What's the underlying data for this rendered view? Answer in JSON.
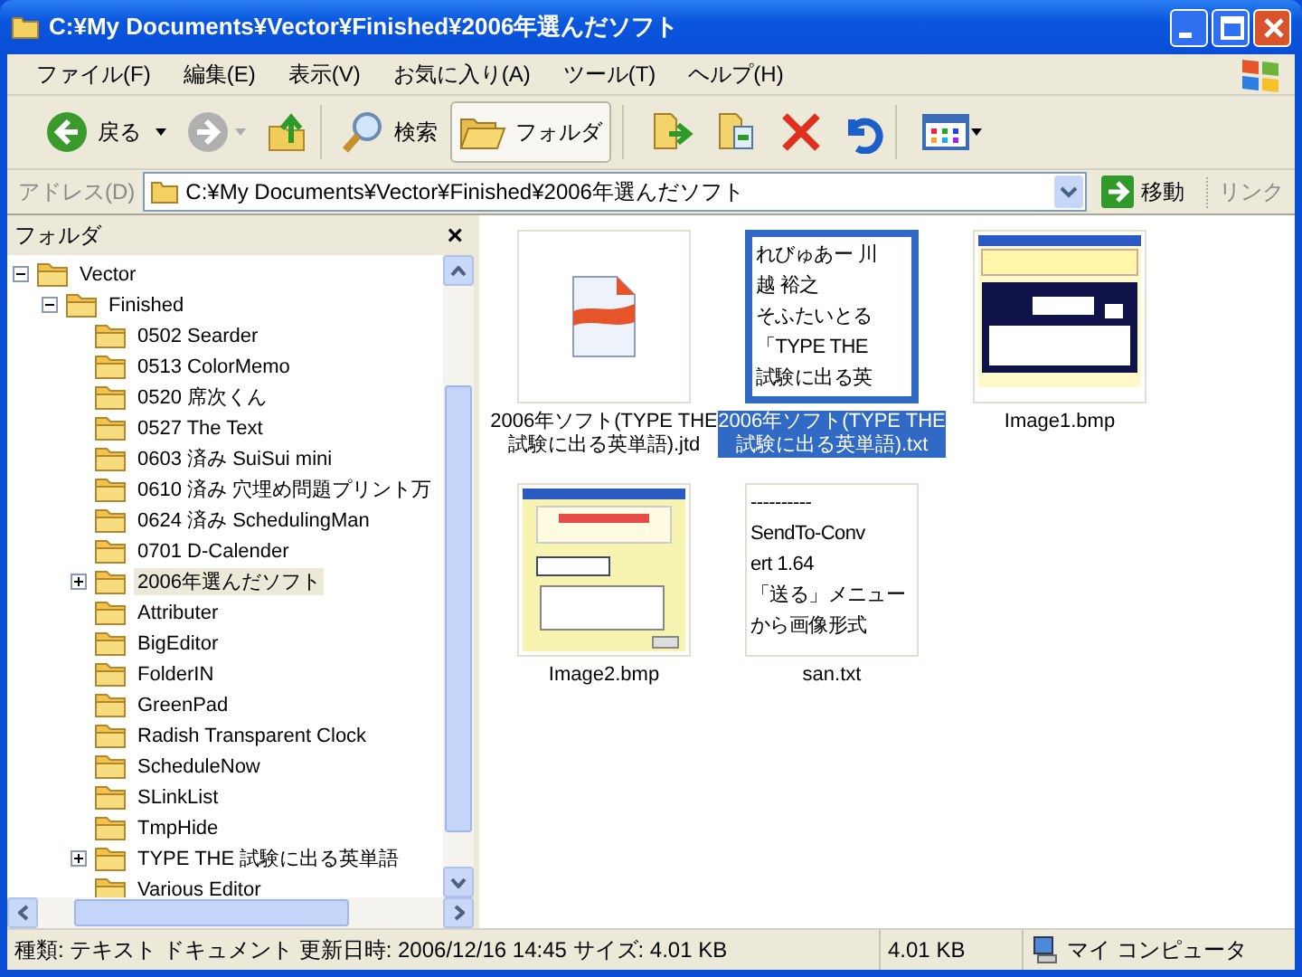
{
  "window": {
    "title": "C:¥My Documents¥Vector¥Finished¥2006年選んだソフト"
  },
  "menu": [
    "ファイル(F)",
    "編集(E)",
    "表示(V)",
    "お気に入り(A)",
    "ツール(T)",
    "ヘルプ(H)"
  ],
  "toolbar": {
    "back": "戻る",
    "search": "検索",
    "folders": {
      "label": "フォルダ",
      "selected": true
    }
  },
  "address": {
    "label": "アドレス(D)",
    "value": "C:¥My Documents¥Vector¥Finished¥2006年選んだソフト",
    "go": "移動",
    "links": "リンク"
  },
  "folder_pane": {
    "title": "フォルダ",
    "close": "×",
    "tree": [
      {
        "label": "Vector",
        "selected": false,
        "expanded": true,
        "children": [
          {
            "label": "Finished",
            "selected": false,
            "expanded": true,
            "children": [
              {
                "label": "0502 Searder",
                "selected": false
              },
              {
                "label": "0513 ColorMemo",
                "selected": false
              },
              {
                "label": "0520 席次くん",
                "selected": false
              },
              {
                "label": "0527 The Text",
                "selected": false
              },
              {
                "label": "0603 済み  SuiSui mini",
                "selected": false
              },
              {
                "label": "0610 済み  穴埋め問題プリント万",
                "selected": false
              },
              {
                "label": "0624 済み  SchedulingMan",
                "selected": false
              },
              {
                "label": "0701 D-Calender",
                "selected": false
              },
              {
                "label": "2006年選んだソフト",
                "selected": true,
                "expanded": false
              },
              {
                "label": "Attributer",
                "selected": false
              },
              {
                "label": "BigEditor",
                "selected": false
              },
              {
                "label": "FolderIN",
                "selected": false
              },
              {
                "label": "GreenPad",
                "selected": false
              },
              {
                "label": "Radish Transparent Clock",
                "selected": false
              },
              {
                "label": "ScheduleNow",
                "selected": false
              },
              {
                "label": "SLinkList",
                "selected": false
              },
              {
                "label": "TmpHide",
                "selected": false
              },
              {
                "label": "TYPE THE 試験に出る英単語",
                "selected": false,
                "expanded": false
              },
              {
                "label": "Various Editor",
                "selected": false
              }
            ]
          }
        ]
      }
    ]
  },
  "files": [
    {
      "name": "2006年ソフト(TYPE THE 試験に出る英単語).jtd",
      "kind": "document",
      "selected": false
    },
    {
      "name": "2006年ソフト(TYPE THE 試験に出る英単語).txt",
      "kind": "text",
      "selected": true,
      "preview": [
        "れびゅあー 川",
        "越 裕之",
        "そふたいとる",
        "「TYPE THE",
        "試験に出る英"
      ]
    },
    {
      "name": "Image1.bmp",
      "kind": "image",
      "selected": false
    },
    {
      "name": "Image2.bmp",
      "kind": "image",
      "selected": false
    },
    {
      "name": "san.txt",
      "kind": "text",
      "selected": false,
      "preview": [
        "----------",
        "SendTo-Conv",
        "ert 1.64",
        "「送る」メニュー",
        "から画像形式"
      ]
    }
  ],
  "status_bar": {
    "details": "種類: テキスト ドキュメント 更新日時: 2006/12/16 14:45 サイズ: 4.01 KB",
    "size": "4.01 KB",
    "zone": "マイ コンピュータ"
  }
}
